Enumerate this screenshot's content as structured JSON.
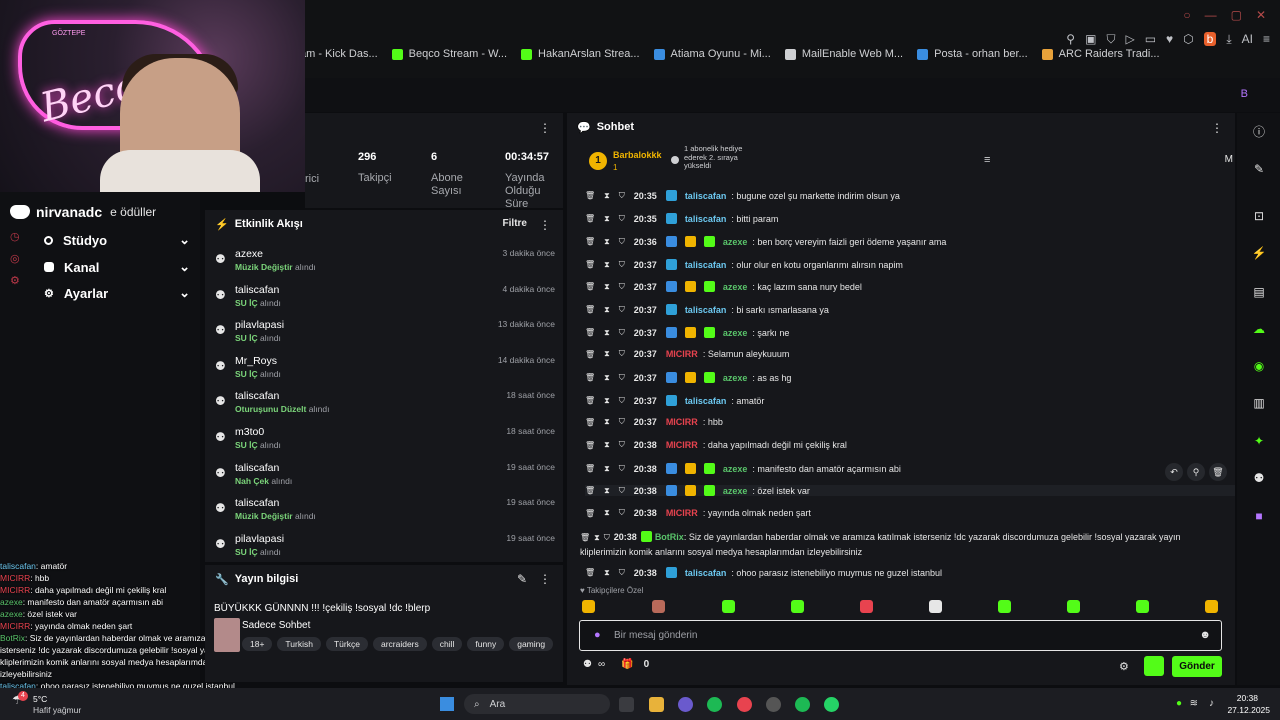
{
  "browser": {
    "bookmarks": [
      {
        "label": "am - Kick Das...",
        "color": "#53fc18"
      },
      {
        "label": "Beqco Stream - W...",
        "color": "#53fc18"
      },
      {
        "label": "HakanArslan Strea...",
        "color": "#53fc18"
      },
      {
        "label": "Atiama Oyunu - Mi...",
        "color": "#3a8de0"
      },
      {
        "label": "MailEnable Web M...",
        "color": "#cfd0d3"
      },
      {
        "label": "Posta - orhan ber...",
        "color": "#3a8de0"
      },
      {
        "label": "ARC Raiders Tradi...",
        "color": "#e8a23a"
      }
    ],
    "ai_label": "AI"
  },
  "webcam": {
    "neon_text": "Beco",
    "sign_text": "GÖZTEPE"
  },
  "leftnav": {
    "discord_user": "nirvanadc",
    "discord_suffix": "e ödüller",
    "items": [
      {
        "label": "Stüdyo"
      },
      {
        "label": "Kanal"
      },
      {
        "label": "Ayarlar"
      }
    ]
  },
  "overlay_chat": [
    {
      "user": "taliscafan",
      "text": ": amatör",
      "cls": "u1"
    },
    {
      "user": "MICIRR",
      "text": ": hbb",
      "cls": "u2"
    },
    {
      "user": "MICIRR",
      "text": ": daha yapılmadı değil mi çekiliş kral",
      "cls": "u2"
    },
    {
      "user": "azexe",
      "text": ": manifesto dan amatör açarmısın abi",
      "cls": "u3"
    },
    {
      "user": "azexe",
      "text": ": özel istek var",
      "cls": "u3"
    },
    {
      "user": "MICIRR",
      "text": ": yayında olmak neden şart",
      "cls": "u2"
    },
    {
      "user": "BotRix",
      "text": ": Siz de yayınlardan haberdar olmak ve aramıza katılmak isterseniz !dc yazarak discordumuza gelebilir !sosyal yazarak yayın kliplerimizin komik anlarını sosyal medya hesaplarımdan izleyebilirsiniz",
      "cls": "u3"
    },
    {
      "user": "taliscafan",
      "text": ": ohoo parasız istenebiliyo muymus ne guzel istanbul",
      "cls": "u1"
    }
  ],
  "stats": {
    "partial_label": "rici",
    "followers_value": "296",
    "followers_label": "Takipçi",
    "subs_value": "6",
    "subs_label": "Abone Sayısı",
    "uptime_value": "00:34:57",
    "uptime_label": "Yayında Olduğu Süre"
  },
  "activity": {
    "title": "Etkinlik Akışı",
    "filter_label": "Filtre",
    "received_word": "alındı",
    "events": [
      {
        "user": "azexe",
        "reward": "Müzik Değiştir",
        "time": "3 dakika önce"
      },
      {
        "user": "taliscafan",
        "reward": "SU İÇ",
        "time": "4 dakika önce"
      },
      {
        "user": "pilavlapasi",
        "reward": "SU İÇ",
        "time": "13 dakika önce"
      },
      {
        "user": "Mr_Roys",
        "reward": "SU İÇ",
        "time": "14 dakika önce"
      },
      {
        "user": "taliscafan",
        "reward": "Oturuşunu Düzelt",
        "time": "18 saat önce"
      },
      {
        "user": "m3to0",
        "reward": "SU İÇ",
        "time": "18 saat önce"
      },
      {
        "user": "taliscafan",
        "reward": "Nah Çek",
        "time": "19 saat önce"
      },
      {
        "user": "taliscafan",
        "reward": "Müzik Değiştir",
        "time": "19 saat önce"
      },
      {
        "user": "pilavlapasi",
        "reward": "SU İÇ",
        "time": "19 saat önce"
      }
    ]
  },
  "stream_info": {
    "title": "Yayın bilgisi",
    "stream_title": "BÜYÜKKK GÜNNNN !!! !çekiliş !sosyal !dc !blerp",
    "category": "Sadece Sohbet",
    "tags": [
      "18+",
      "Turkish",
      "Türkçe",
      "arcraiders",
      "chill",
      "funny",
      "gaming"
    ]
  },
  "chat": {
    "title": "Sohbet",
    "pinned_user": "Barbalokkk",
    "pinned_rank": "1",
    "pinned_sub_count": "1",
    "pinned_text": "1 abonelik hediye ederek 2. sıraya yükseldi",
    "m_label": "M",
    "messages": [
      {
        "time": "20:35",
        "user": "taliscafan",
        "cls": "u-blue",
        "text": ": bugune ozel şu markette indirim olsun ya",
        "badges": [
          "#2fa0d8"
        ]
      },
      {
        "time": "20:35",
        "user": "taliscafan",
        "cls": "u-blue",
        "text": ": bitti param",
        "badges": [
          "#2fa0d8"
        ]
      },
      {
        "time": "20:36",
        "user": "azexe",
        "cls": "u-green",
        "text": ": ben borç vereyim faizli geri ödeme yaşanır ama",
        "badges": [
          "#3a8de0",
          "#f0b400",
          "#53fc18"
        ]
      },
      {
        "time": "20:37",
        "user": "taliscafan",
        "cls": "u-blue",
        "text": ": olur olur en kotu organlarımı alırsın napim",
        "badges": [
          "#2fa0d8"
        ]
      },
      {
        "time": "20:37",
        "user": "azexe",
        "cls": "u-green",
        "text": ": kaç lazım sana nury bedel",
        "badges": [
          "#3a8de0",
          "#f0b400",
          "#53fc18"
        ]
      },
      {
        "time": "20:37",
        "user": "taliscafan",
        "cls": "u-blue",
        "text": ": bi sarkı ısmarlasana ya",
        "badges": [
          "#2fa0d8"
        ]
      },
      {
        "time": "20:37",
        "user": "azexe",
        "cls": "u-green",
        "text": ": şarkı ne",
        "badges": [
          "#3a8de0",
          "#f0b400",
          "#53fc18"
        ]
      },
      {
        "time": "20:37",
        "user": "MICIRR",
        "cls": "u-red",
        "text": ": Selamun aleykuuum",
        "badges": []
      },
      {
        "time": "20:37",
        "user": "azexe",
        "cls": "u-green",
        "text": ": as as hg",
        "badges": [
          "#3a8de0",
          "#f0b400",
          "#53fc18"
        ]
      },
      {
        "time": "20:37",
        "user": "taliscafan",
        "cls": "u-blue",
        "text": ": amatör",
        "badges": [
          "#2fa0d8"
        ]
      },
      {
        "time": "20:37",
        "user": "MICIRR",
        "cls": "u-red",
        "text": ": hbb",
        "badges": []
      },
      {
        "time": "20:38",
        "user": "MICIRR",
        "cls": "u-red",
        "text": ": daha yapılmadı değil mi çekiliş kral",
        "badges": []
      },
      {
        "time": "20:38",
        "user": "azexe",
        "cls": "u-green",
        "text": ": manifesto dan amatör açarmısın abi",
        "badges": [
          "#3a8de0",
          "#f0b400",
          "#53fc18"
        ]
      },
      {
        "time": "20:38",
        "user": "azexe",
        "cls": "u-green",
        "text": ": özel istek var",
        "badges": [
          "#3a8de0",
          "#f0b400",
          "#53fc18"
        ]
      },
      {
        "time": "20:38",
        "user": "MICIRR",
        "cls": "u-red",
        "text": ": yayında olmak neden şart",
        "badges": []
      },
      {
        "time": "20:38",
        "user": "BotRix",
        "cls": "u-green",
        "text": ": Siz de yayınlardan haberdar olmak ve aramıza katılmak isterseniz !dc yazarak discordumuza gelebilir !sosyal yazarak yayın kliplerimizin komik anlarını sosyal medya hesaplarımdan izleyebilirsiniz",
        "badges": [
          "#53fc18"
        ]
      },
      {
        "time": "20:38",
        "user": "taliscafan",
        "cls": "u-blue",
        "text": ": ohoo parasız istenebiliyo muymus ne guzel istanbul",
        "badges": [
          "#2fa0d8"
        ]
      }
    ],
    "emote_section": "Takipçilere Özel",
    "input_placeholder": "Bir mesaj gönderin",
    "points_value": "0",
    "send_label": "Gönder"
  },
  "taskbar": {
    "weather_temp": "5°C",
    "weather_desc": "Hafif yağmur",
    "weather_badge": "4",
    "search_placeholder": "Ara",
    "time": "20:38",
    "date": "27.12.2025"
  }
}
